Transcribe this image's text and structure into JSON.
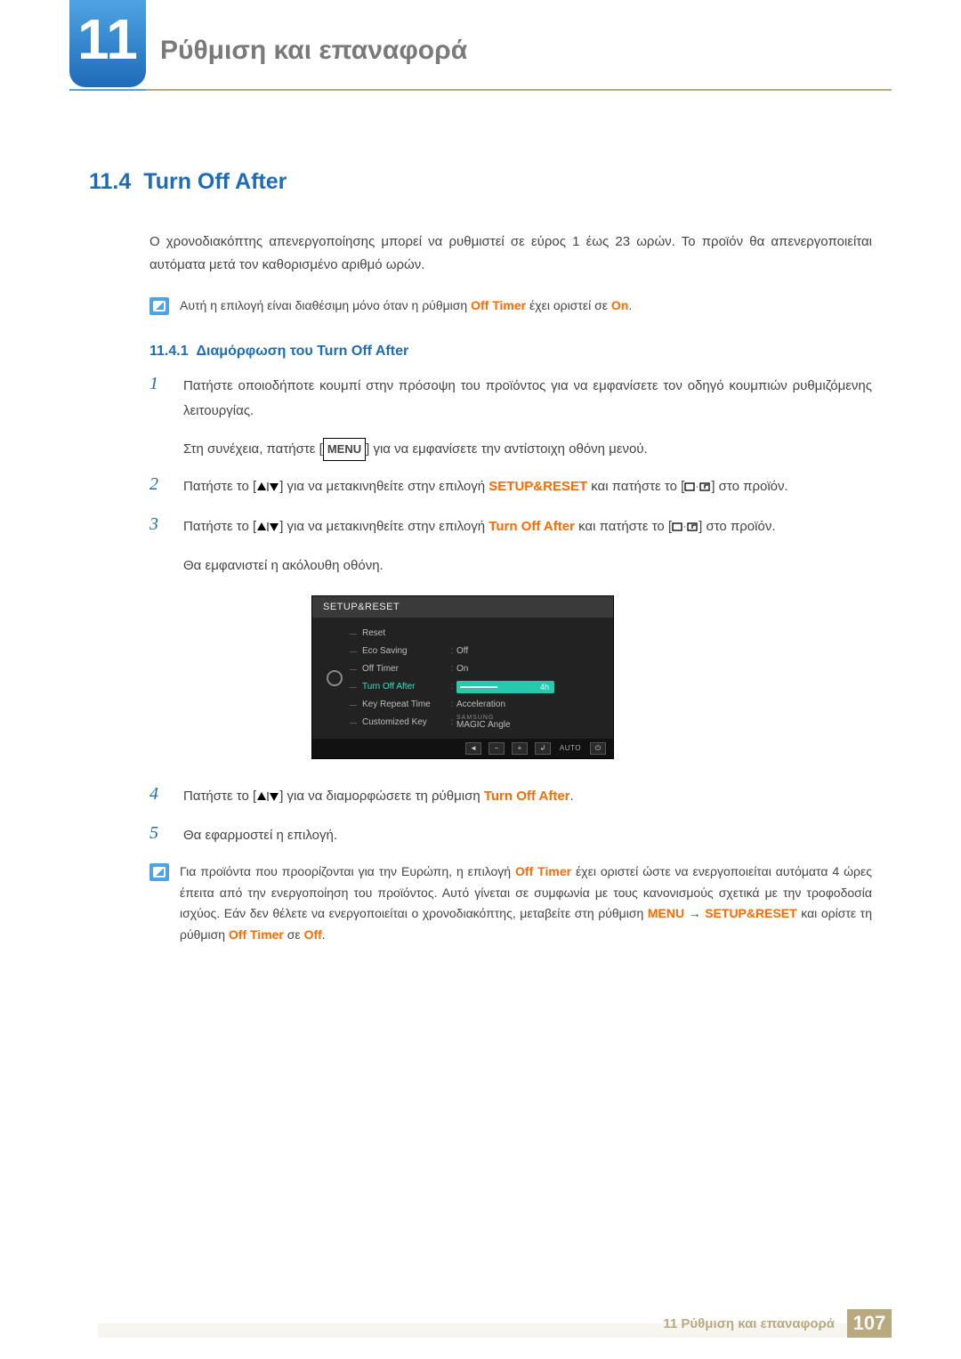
{
  "chapter": {
    "number": "11",
    "title": "Ρύθμιση και επαναφορά"
  },
  "section": {
    "number": "11.4",
    "title": "Turn Off After"
  },
  "intro": "Ο χρονοδιακόπτης απενεργοποίησης μπορεί να ρυθμιστεί σε εύρος 1 έως 23 ωρών. Το προϊόν θα απενεργοποιείται αυτόματα μετά τον καθορισμένο αριθμό ωρών.",
  "note1": {
    "pre": "Αυτή η επιλογή είναι διαθέσιμη μόνο όταν η ρύθμιση ",
    "hl1": "Off Timer",
    "mid": " έχει οριστεί σε ",
    "hl2": "On",
    "post": "."
  },
  "sub": {
    "number": "11.4.1",
    "title": "Διαμόρφωση του Turn Off After"
  },
  "steps": {
    "s1a": "Πατήστε οποιοδήποτε κουμπί στην πρόσοψη του προϊόντος για να εμφανίσετε τον οδηγό κουμπιών ρυθμιζόμενης λειτουργίας.",
    "s1b_pre": "Στη συνέχεια, πατήστε [",
    "s1b_menu": "MENU",
    "s1b_post": "] για να εμφανίσετε την αντίστοιχη οθόνη μενού.",
    "s2_pre": "Πατήστε το [",
    "s2_mid1": "] για να μετακινηθείτε στην επιλογή ",
    "s2_hl": "SETUP&RESET",
    "s2_mid2": " και πατήστε το [",
    "s2_post": "] στο προϊόν.",
    "s3_pre": "Πατήστε το [",
    "s3_mid1": "] για να μετακινηθείτε στην επιλογή ",
    "s3_hl": "Turn Off After",
    "s3_mid2": " και πατήστε το [",
    "s3_post": "] στο προϊόν.",
    "s3b": "Θα εμφανιστεί η ακόλουθη οθόνη.",
    "s4_pre": "Πατήστε το [",
    "s4_mid": "] για να διαμορφώσετε τη ρύθμιση ",
    "s4_hl": "Turn Off After",
    "s4_post": ".",
    "s5": "Θα εφαρμοστεί η επιλογή."
  },
  "note2": {
    "p1": "Για προϊόντα που προορίζονται για την Ευρώπη, η επιλογή ",
    "hl1": "Off Timer",
    "p2": " έχει οριστεί ώστε να ενεργοποιείται αυτόματα 4 ώρες έπειτα από την ενεργοποίηση του προϊόντος. Αυτό γίνεται σε συμφωνία με τους κανονισμούς σχετικά με την τροφοδοσία ισχύος. Εάν δεν θέλετε να ενεργοποιείται ο χρονοδιακόπτης, μεταβείτε στη ρύθμιση ",
    "hl2": "MENU",
    "arrow": " → ",
    "hl3": "SETUP&RESET",
    "p3": " και ορίστε τη ρύθμιση ",
    "hl4": "Off Timer",
    "p4": " σε ",
    "hl5": "Off",
    "p5": "."
  },
  "osd": {
    "title": "SETUP&RESET",
    "rows": [
      {
        "label": "Reset",
        "value": ""
      },
      {
        "label": "Eco Saving",
        "value": "Off"
      },
      {
        "label": "Off Timer",
        "value": "On"
      },
      {
        "label": "Turn Off After",
        "value": "4h",
        "active": true
      },
      {
        "label": "Key Repeat Time",
        "value": "Acceleration"
      },
      {
        "label": "Customized Key",
        "value_small": "SAMSUNG",
        "value": "MAGIC Angle"
      }
    ],
    "foot_auto": "AUTO"
  },
  "footer": {
    "text": "11 Ρύθμιση και επαναφορά",
    "page": "107"
  }
}
